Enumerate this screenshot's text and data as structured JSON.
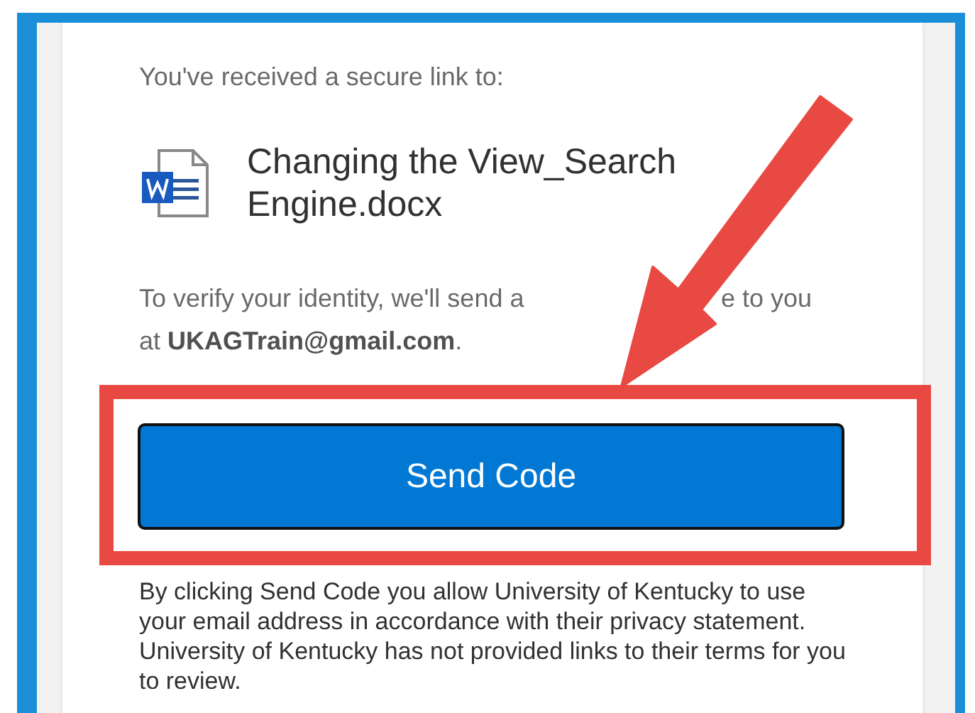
{
  "intro": "You've received a secure link to:",
  "file": {
    "name": "Changing the View_Search Engine.docx"
  },
  "verify": {
    "before": "To verify your identity, we'll send a",
    "after": "e to you",
    "line2": "at **UKAGTrain@gmail.com**."
  },
  "button": {
    "label": "Send Code"
  },
  "disclaimer": "By clicking Send Code you allow University of Kentucky to use your email address in accordance with their privacy statement. University of Kentucky has not provided links to their terms for you to review."
}
